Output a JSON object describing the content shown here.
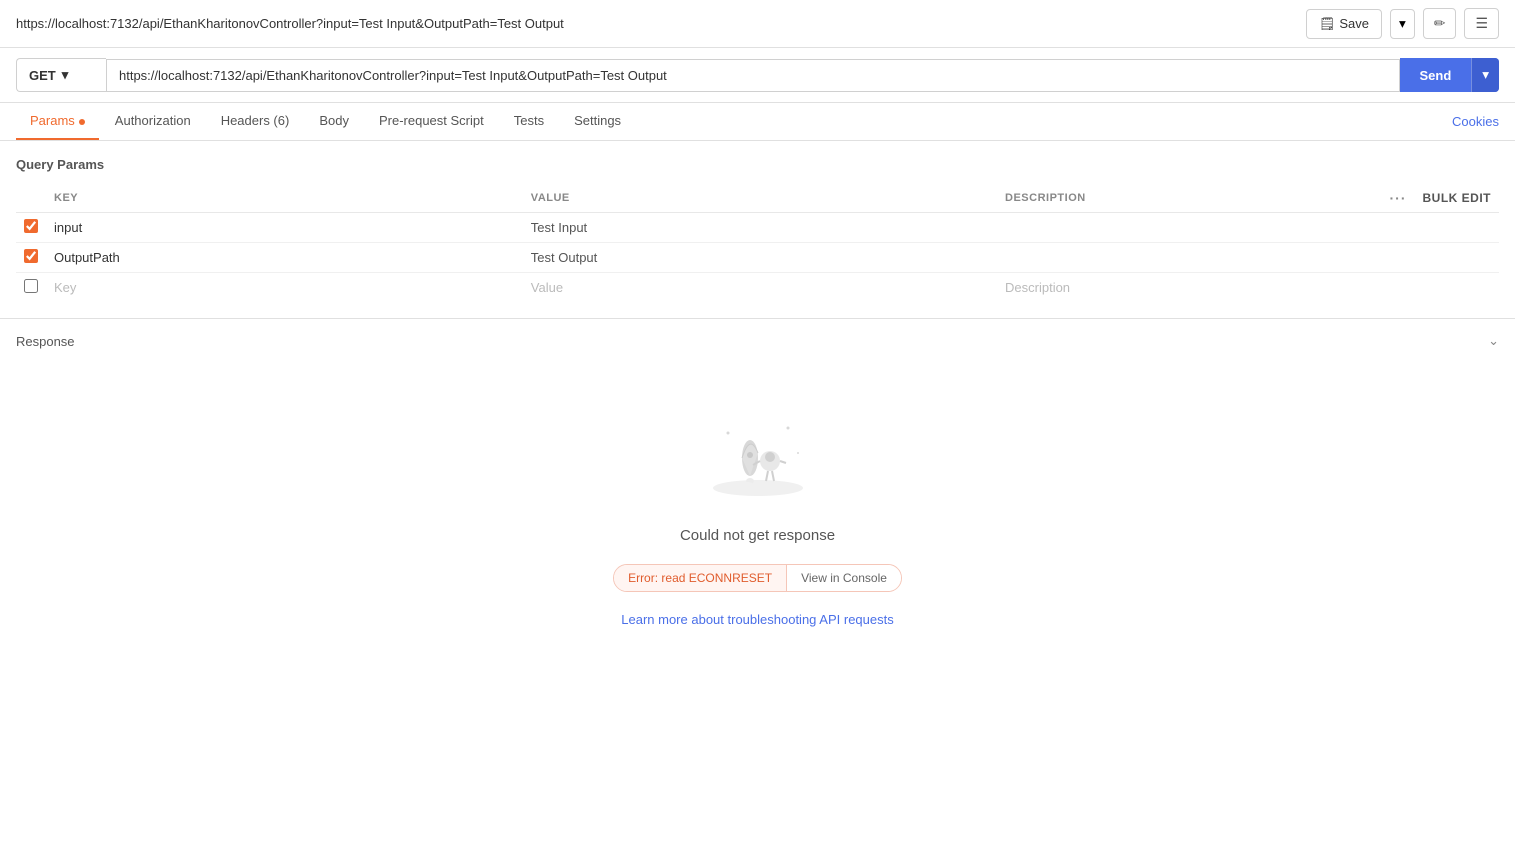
{
  "topBar": {
    "url": "https://localhost:7132/api/EthanKharitonovController?input=Test Input&OutputPath=Test Output",
    "saveLabel": "Save",
    "editIconLabel": "✏",
    "docIconLabel": "☰"
  },
  "requestBar": {
    "method": "GET",
    "urlValue": "https://localhost:7132/api/EthanKharitonovController?input=Test Input&OutputPath=Test Output",
    "sendLabel": "Send"
  },
  "tabs": [
    {
      "id": "params",
      "label": "Params",
      "hasDot": true,
      "active": true
    },
    {
      "id": "authorization",
      "label": "Authorization",
      "hasDot": false,
      "active": false
    },
    {
      "id": "headers",
      "label": "Headers (6)",
      "hasDot": false,
      "active": false
    },
    {
      "id": "body",
      "label": "Body",
      "hasDot": false,
      "active": false
    },
    {
      "id": "pre-request",
      "label": "Pre-request Script",
      "hasDot": false,
      "active": false
    },
    {
      "id": "tests",
      "label": "Tests",
      "hasDot": false,
      "active": false
    },
    {
      "id": "settings",
      "label": "Settings",
      "hasDot": false,
      "active": false
    }
  ],
  "cookiesLabel": "Cookies",
  "queryParams": {
    "sectionTitle": "Query Params",
    "columns": {
      "key": "KEY",
      "value": "VALUE",
      "description": "DESCRIPTION",
      "bulkEdit": "Bulk Edit"
    },
    "rows": [
      {
        "checked": true,
        "key": "input",
        "value": "Test Input",
        "description": ""
      },
      {
        "checked": true,
        "key": "OutputPath",
        "value": "Test Output",
        "description": ""
      }
    ],
    "placeholderRow": {
      "key": "Key",
      "value": "Value",
      "description": "Description"
    }
  },
  "response": {
    "title": "Response",
    "noResponseText": "Could not get response",
    "errorText": "Error: read ECONNRESET",
    "viewConsoleLabel": "View in Console",
    "troubleshootLabel": "Learn more about troubleshooting API requests"
  }
}
